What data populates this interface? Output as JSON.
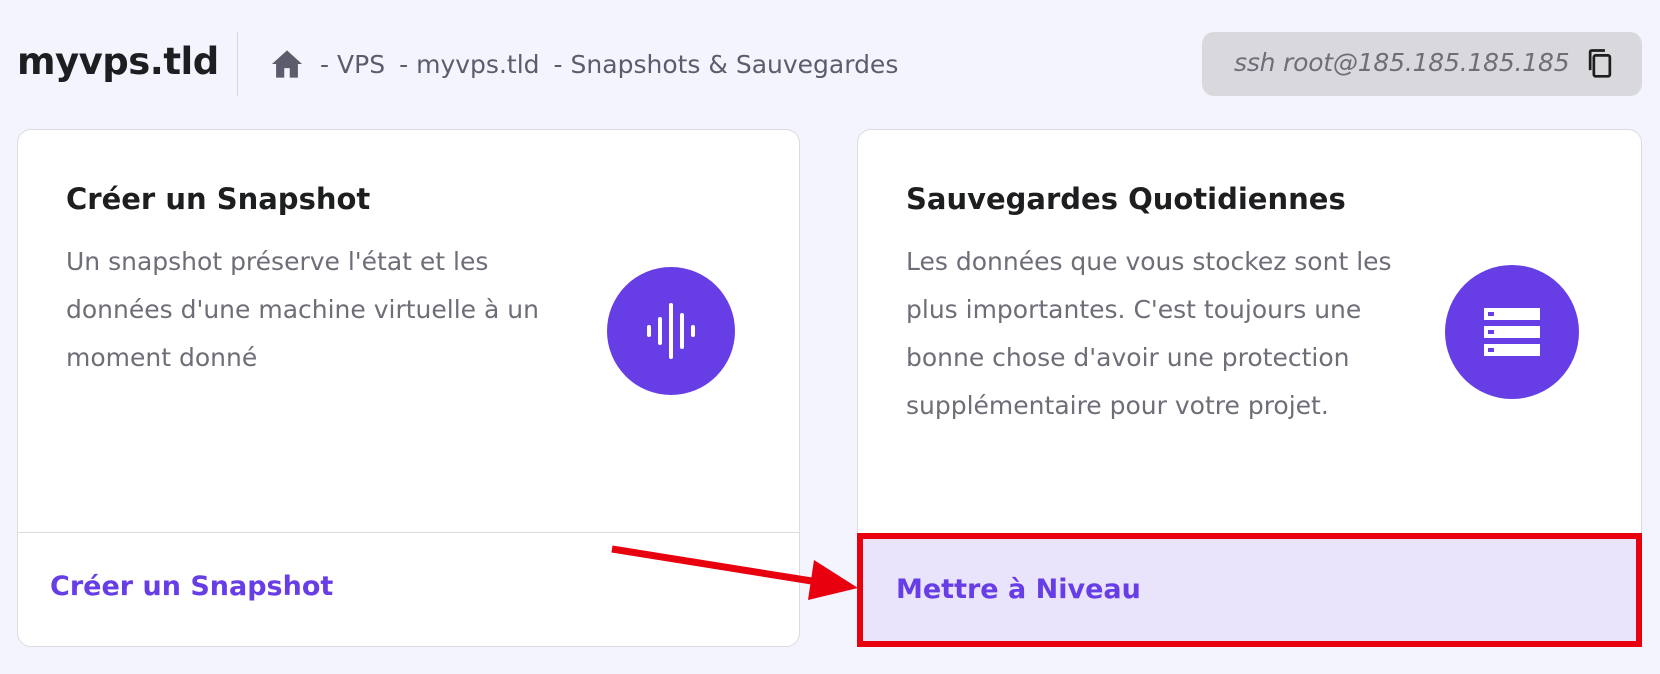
{
  "header": {
    "site_title": "myvps.tld",
    "breadcrumb": [
      {
        "label": "VPS"
      },
      {
        "label": "myvps.tld"
      },
      {
        "label": "Snapshots & Sauvegardes"
      }
    ],
    "separator": "-",
    "ssh_command": "ssh root@185.185.185.185"
  },
  "cards": {
    "snapshot": {
      "title": "Créer un Snapshot",
      "description": "Un snapshot préserve l'état et les données d'une machine virtuelle à un moment donné",
      "icon": "soundwave-icon",
      "action_label": "Créer un Snapshot"
    },
    "backups": {
      "title": "Sauvegardes Quotidiennes",
      "description": "Les données que vous stockez sont les plus importantes. C'est toujours une bonne chose d'avoir une protection supplémentaire pour votre projet.",
      "icon": "server-stack-icon",
      "action_label": "Mettre à Niveau"
    }
  },
  "colors": {
    "accent": "#673de6",
    "annotation": "#e8000f",
    "background": "#f4f4fe"
  }
}
